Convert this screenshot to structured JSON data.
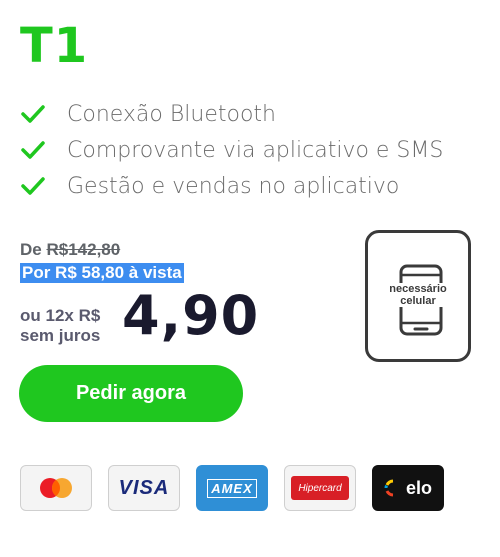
{
  "product": {
    "title": "T1"
  },
  "features": [
    {
      "text": "Conexão Bluetooth"
    },
    {
      "text": "Comprovante via aplicativo e SMS"
    },
    {
      "text": "Gestão e vendas no aplicativo"
    }
  ],
  "pricing": {
    "old_prefix": "De ",
    "old_price": "R$142,80",
    "vista": "Por R$ 58,80 à vista",
    "installment_line1": "ou 12x R$",
    "installment_line2": "sem juros",
    "installment_value": "4,90"
  },
  "cta": {
    "label": "Pedir agora"
  },
  "badge": {
    "line1": "necessário",
    "line2": "celular"
  },
  "payments": [
    {
      "name": "Mastercard",
      "icon": "mastercard-icon"
    },
    {
      "name": "VISA",
      "icon": "visa-icon"
    },
    {
      "name": "AMEX",
      "icon": "amex-icon"
    },
    {
      "name": "Hipercard",
      "icon": "hipercard-icon"
    },
    {
      "name": "elo",
      "icon": "elo-icon"
    }
  ],
  "colors": {
    "accent": "#1fc71f",
    "highlight": "#3d8df0",
    "text": "#6b6b6b",
    "dark": "#1a1a2e"
  }
}
